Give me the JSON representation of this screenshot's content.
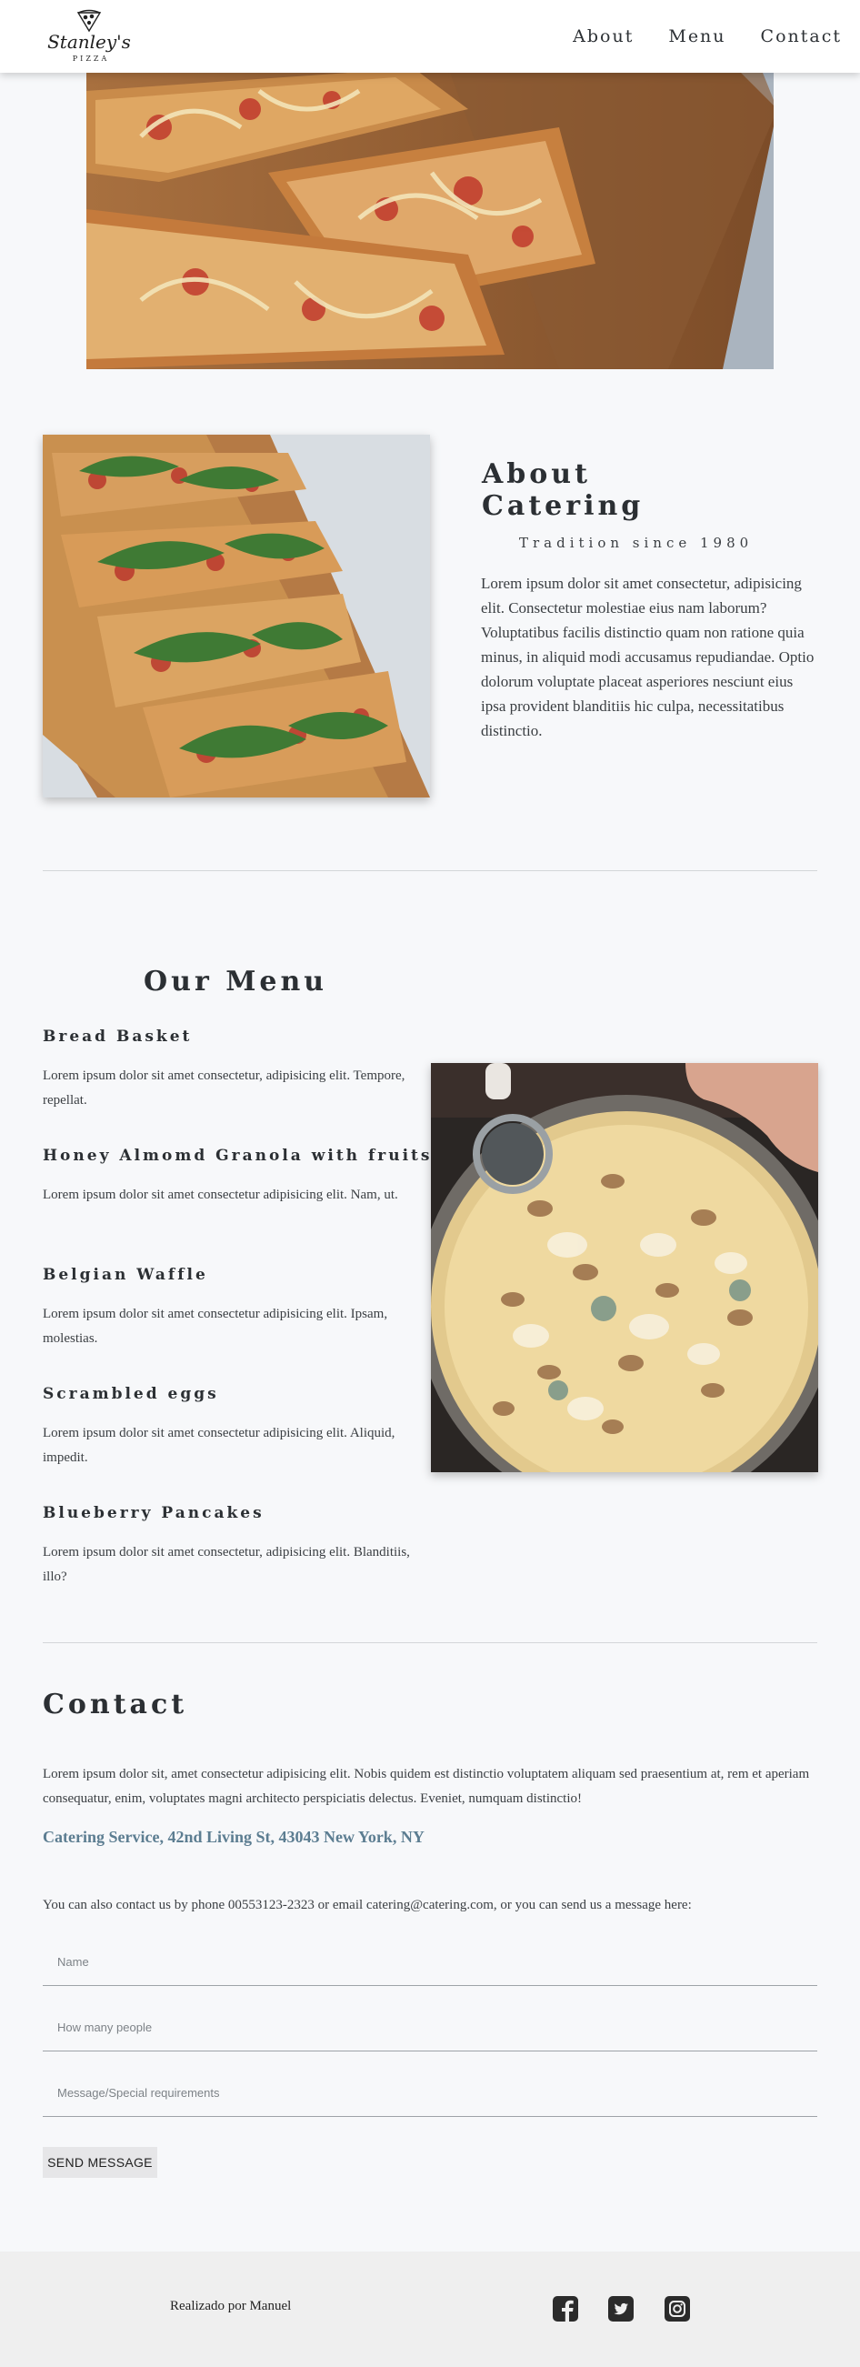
{
  "header": {
    "logo_name": "Stanley's",
    "logo_sub": "PIZZA",
    "nav": [
      {
        "label": "About"
      },
      {
        "label": "Menu"
      },
      {
        "label": "Contact"
      }
    ]
  },
  "about": {
    "title": "About Catering",
    "subtitle": "Tradition since 1980",
    "text": "Lorem ipsum dolor sit amet consectetur, adipisicing elit. Consectetur molestiae eius nam laborum? Voluptatibus facilis distinctio quam non ratione quia minus, in aliquid modi accusamus repudiandae. Optio dolorum voluptate placeat asperiores nesciunt eius ipsa provident blanditiis hic culpa, necessitatibus distinctio."
  },
  "menu": {
    "title": "Our Menu",
    "items": [
      {
        "name": "Bread Basket",
        "description": "Lorem ipsum dolor sit amet consectetur, adipisicing elit. Tempore, repellat."
      },
      {
        "name": "Honey Almomd Granola with fruits",
        "description": "Lorem ipsum dolor sit amet consectetur adipisicing elit. Nam, ut."
      },
      {
        "name": "Belgian Waffle",
        "description": "Lorem ipsum dolor sit amet consectetur adipisicing elit. Ipsam, molestias."
      },
      {
        "name": "Scrambled eggs",
        "description": "Lorem ipsum dolor sit amet consectetur adipisicing elit. Aliquid, impedit."
      },
      {
        "name": "Blueberry Pancakes",
        "description": "Lorem ipsum dolor sit amet consectetur, adipisicing elit. Blanditiis, illo?"
      }
    ]
  },
  "contact": {
    "title": "Contact",
    "text": "Lorem ipsum dolor sit, amet consectetur adipisicing elit. Nobis quidem est distinctio voluptatem aliquam sed praesentium at, rem et aperiam consequatur, enim, voluptates magni architecto perspiciatis delectus. Eveniet, numquam distinctio!",
    "address": "Catering Service, 42nd Living St, 43043 New York, NY",
    "phone_text": "You can also contact us by phone 00553123-2323 or email catering@catering.com, or you can send us a message here:",
    "form": {
      "name_placeholder": "Name",
      "people_placeholder": "How many people",
      "message_placeholder": "Message/Special requirements",
      "send_label": "SEND MESSAGE"
    }
  },
  "footer": {
    "credit": "Realizado por Manuel",
    "social_icons": [
      "facebook-icon",
      "twitter-icon",
      "instagram-icon"
    ]
  },
  "colors": {
    "background": "#f7f8fa",
    "header_bg": "#ffffff",
    "text": "#2b2f33",
    "address_accent": "#5c7d91",
    "footer_bg": "#efefef",
    "button_bg": "#e6e6e8"
  }
}
